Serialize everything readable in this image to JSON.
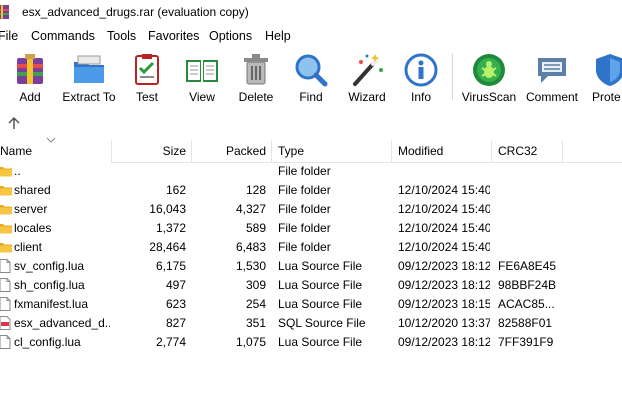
{
  "window": {
    "title": "esx_advanced_drugs.rar (evaluation copy)"
  },
  "menu": [
    "File",
    "Commands",
    "Tools",
    "Favorites",
    "Options",
    "Help"
  ],
  "toolbar": [
    {
      "label": "Add",
      "icon": "add-icon"
    },
    {
      "label": "Extract To",
      "icon": "extract-to-icon"
    },
    {
      "label": "Test",
      "icon": "test-icon"
    },
    {
      "label": "View",
      "icon": "view-icon"
    },
    {
      "label": "Delete",
      "icon": "delete-icon"
    },
    {
      "label": "Find",
      "icon": "find-icon"
    },
    {
      "label": "Wizard",
      "icon": "wizard-icon"
    },
    {
      "label": "Info",
      "icon": "info-icon"
    },
    {
      "label": "VirusScan",
      "icon": "virusscan-icon"
    },
    {
      "label": "Comment",
      "icon": "comment-icon"
    },
    {
      "label": "Prote",
      "icon": "protect-icon"
    }
  ],
  "columns": {
    "name": "Name",
    "size": "Size",
    "packed": "Packed",
    "type": "Type",
    "modified": "Modified",
    "crc": "CRC32"
  },
  "files": [
    {
      "name": "..",
      "size": "",
      "packed": "",
      "type": "File folder",
      "modified": "",
      "crc": "",
      "icon": "folder-icon"
    },
    {
      "name": "shared",
      "size": "162",
      "packed": "128",
      "type": "File folder",
      "modified": "12/10/2024 15:40",
      "crc": "",
      "icon": "folder-icon"
    },
    {
      "name": "server",
      "size": "16,043",
      "packed": "4,327",
      "type": "File folder",
      "modified": "12/10/2024 15:40",
      "crc": "",
      "icon": "folder-icon"
    },
    {
      "name": "locales",
      "size": "1,372",
      "packed": "589",
      "type": "File folder",
      "modified": "12/10/2024 15:40",
      "crc": "",
      "icon": "folder-icon"
    },
    {
      "name": "client",
      "size": "28,464",
      "packed": "6,483",
      "type": "File folder",
      "modified": "12/10/2024 15:40",
      "crc": "",
      "icon": "folder-icon"
    },
    {
      "name": "sv_config.lua",
      "size": "6,175",
      "packed": "1,530",
      "type": "Lua Source File",
      "modified": "09/12/2023 18:12",
      "crc": "FE6A8E45",
      "icon": "file-icon"
    },
    {
      "name": "sh_config.lua",
      "size": "497",
      "packed": "309",
      "type": "Lua Source File",
      "modified": "09/12/2023 18:12",
      "crc": "98BBF24B",
      "icon": "file-icon"
    },
    {
      "name": "fxmanifest.lua",
      "size": "623",
      "packed": "254",
      "type": "Lua Source File",
      "modified": "09/12/2023 18:15",
      "crc": "ACAC85...",
      "icon": "file-icon"
    },
    {
      "name": "esx_advanced_d...",
      "size": "827",
      "packed": "351",
      "type": "SQL Source File",
      "modified": "10/12/2020 13:37",
      "crc": "82588F01",
      "icon": "sql-file-icon"
    },
    {
      "name": "cl_config.lua",
      "size": "2,774",
      "packed": "1,075",
      "type": "Lua Source File",
      "modified": "09/12/2023 18:12",
      "crc": "7FF391F9",
      "icon": "file-icon"
    }
  ]
}
